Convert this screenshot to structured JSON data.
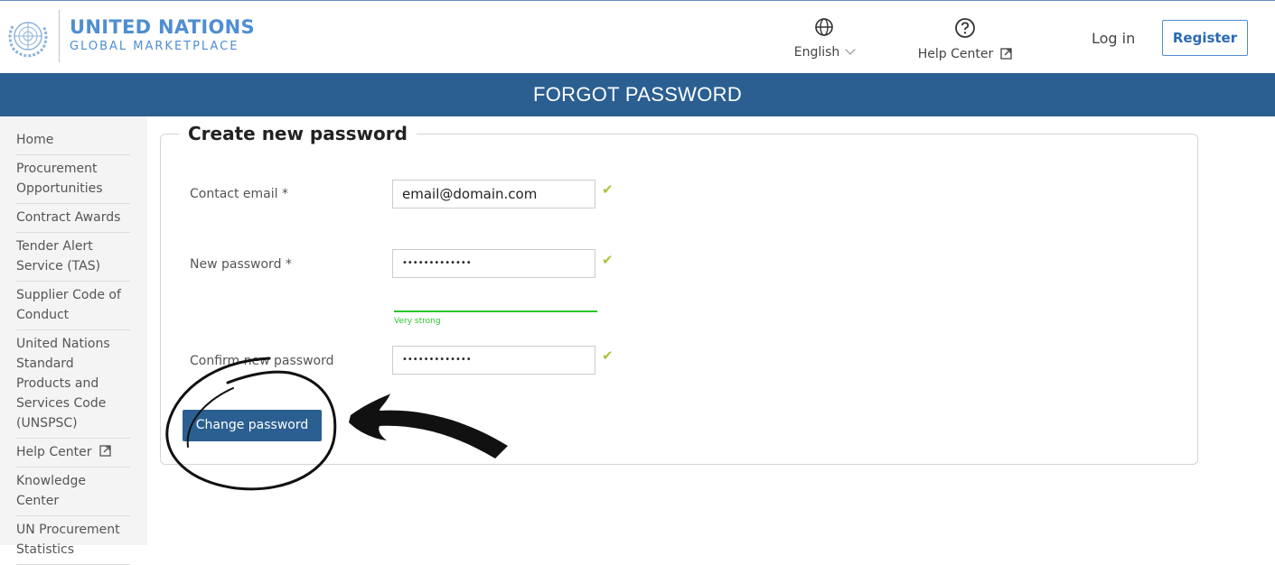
{
  "header": {
    "logo_title": "UNITED NATIONS",
    "logo_subtitle": "GLOBAL MARKETPLACE",
    "language": "English",
    "help_center": "Help Center",
    "login": "Log in",
    "register": "Register"
  },
  "banner": {
    "title": "FORGOT PASSWORD"
  },
  "sidebar": {
    "items": [
      {
        "label": "Home"
      },
      {
        "label": "Procurement Opportunities"
      },
      {
        "label": "Contract Awards"
      },
      {
        "label": "Tender Alert Service (TAS)"
      },
      {
        "label": "Supplier Code of Conduct"
      },
      {
        "label": "United Nations Standard Products and Services Code (UNSPSC)"
      },
      {
        "label": "Help Center",
        "external": true
      },
      {
        "label": "Knowledge Center"
      },
      {
        "label": "UN Procurement Statistics"
      }
    ]
  },
  "form": {
    "legend": "Create new password",
    "email_label": "Contact email *",
    "email_value": "email@domain.com",
    "new_password_label": "New password *",
    "new_password_value": "•••••••••••••",
    "strength_label": "Very strong",
    "confirm_label": "Confirm new password",
    "confirm_value": "•••••••••••••",
    "submit": "Change password"
  },
  "colors": {
    "accent": "#2b5f91",
    "brand_blue": "#4f8ed1",
    "valid_check": "#a8c53a",
    "strength": "#2cc42c"
  }
}
